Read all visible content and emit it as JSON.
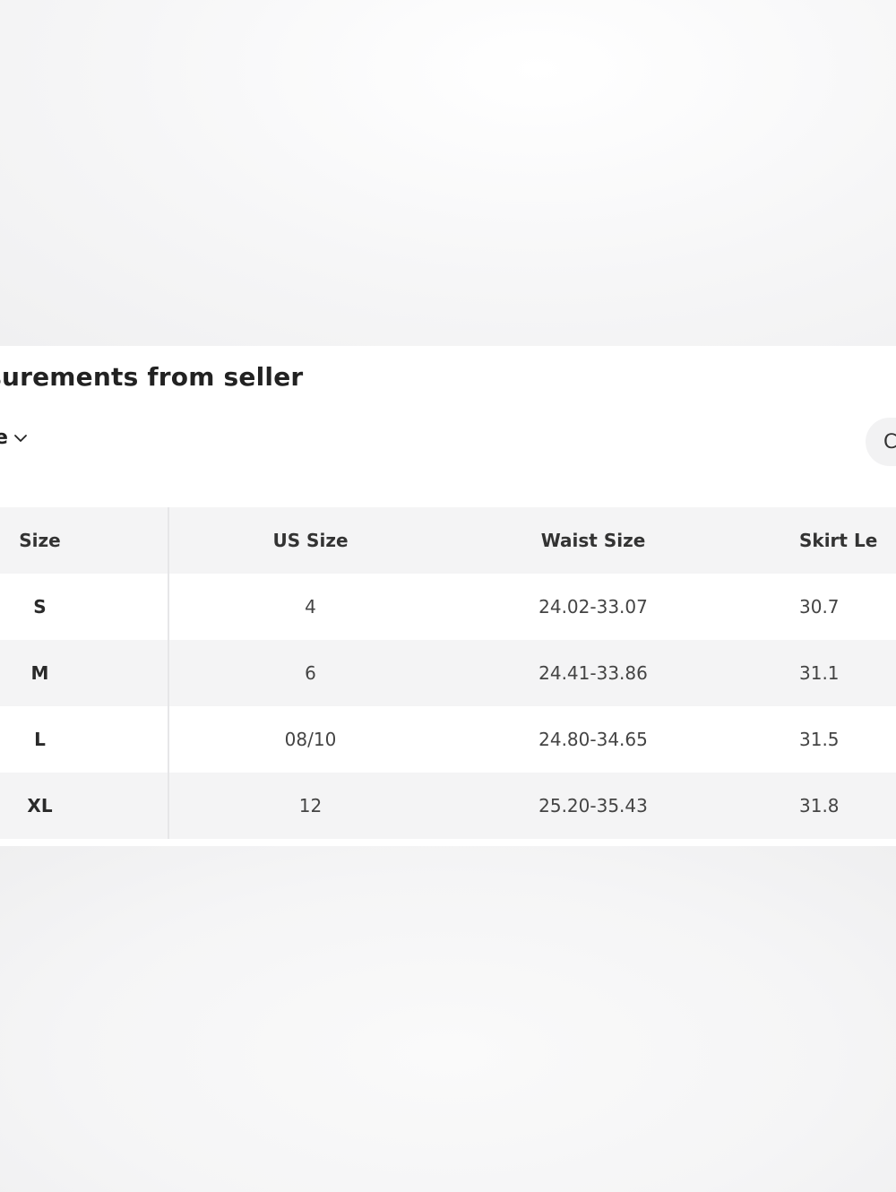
{
  "panel": {
    "title": "asurements from seller",
    "unit_select_label": "e",
    "toggle_label": "C"
  },
  "table": {
    "headers": [
      "Size",
      "US Size",
      "Waist Size",
      "Skirt Le"
    ],
    "rows": [
      [
        "S",
        "4",
        "24.02-33.07",
        "30.7"
      ],
      [
        "M",
        "6",
        "24.41-33.86",
        "31.1"
      ],
      [
        "L",
        "08/10",
        "24.80-34.65",
        "31.5"
      ],
      [
        "XL",
        "12",
        "25.20-35.43",
        "31.8"
      ]
    ]
  },
  "icons": {
    "unit_select": "chevron-down-icon"
  }
}
